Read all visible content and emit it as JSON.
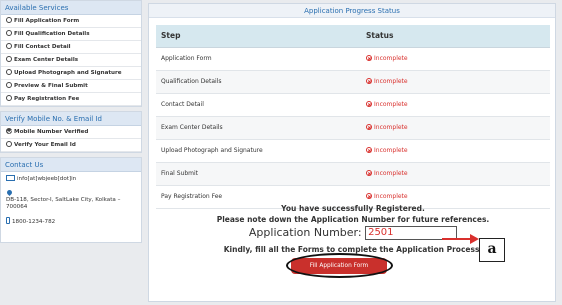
{
  "sidebar": {
    "services": {
      "header": "Available Services",
      "items": [
        "Fill Application Form",
        "Fill Qualification Details",
        "Fill Contact Detail",
        "Exam Center Details",
        "Upload Photograph and Signature",
        "Preview & Final Submit",
        "Pay Registration Fee"
      ]
    },
    "verify": {
      "header": "Verify Mobile No. & Email Id",
      "items": [
        "Mobile Number Verified",
        "Verify Your Email Id"
      ]
    },
    "contact": {
      "header": "Contact Us",
      "email": "info[at]wbjeeb[dot]in",
      "address": "DB-118, Sector-I, SaltLake City, Kolkata – 700064",
      "phone": "1800-1234-782"
    }
  },
  "main": {
    "title": "Application Progress Status",
    "columns": [
      "Step",
      "Status"
    ],
    "rows": [
      {
        "step": "Application Form",
        "status": "Incomplete"
      },
      {
        "step": "Qualification Details",
        "status": "Incomplete"
      },
      {
        "step": "Contact Detail",
        "status": "Incomplete"
      },
      {
        "step": "Exam Center Details",
        "status": "Incomplete"
      },
      {
        "step": "Upload Photograph and Signature",
        "status": "Incomplete"
      },
      {
        "step": "Final Submit",
        "status": "Incomplete"
      },
      {
        "step": "Pay Registration Fee",
        "status": "Incomplete"
      }
    ],
    "msg1": "You have successfully Registered.",
    "msg2": "Please note down the Application Number for future references.",
    "appnum_label": "Application Number:",
    "appnum_value": "2501",
    "msg3": "Kindly, fill all the Forms to complete the Application Process.",
    "button": "Fill Application Form"
  },
  "annotation": {
    "label": "a"
  },
  "colors": {
    "accent": "#2a6fb0",
    "danger": "#d9302d"
  }
}
